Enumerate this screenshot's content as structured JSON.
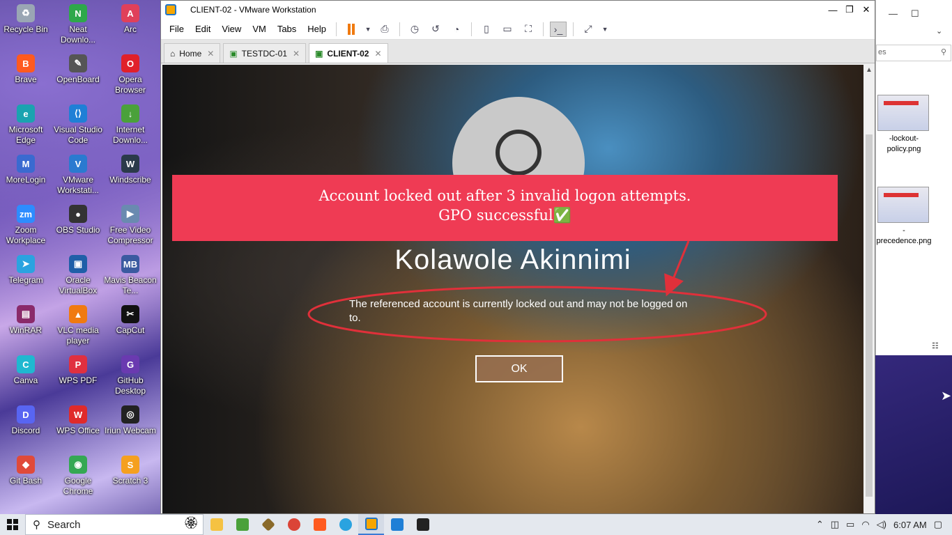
{
  "desktop_icons": [
    {
      "label": "Recycle Bin",
      "color": "#9aa6b4",
      "glyph": "♻"
    },
    {
      "label": "Neat Downlo...",
      "color": "#2ea84a",
      "glyph": "N"
    },
    {
      "label": "Arc",
      "color": "#e0405a",
      "glyph": "A"
    },
    {
      "label": "Brave",
      "color": "#ff5a1f",
      "glyph": "B"
    },
    {
      "label": "OpenBoard",
      "color": "#555555",
      "glyph": "✎"
    },
    {
      "label": "Opera Browser",
      "color": "#e0202a",
      "glyph": "O"
    },
    {
      "label": "Microsoft Edge",
      "color": "#1aa3b0",
      "glyph": "e"
    },
    {
      "label": "Visual Studio Code",
      "color": "#1f7fd6",
      "glyph": "⟨⟩"
    },
    {
      "label": "Internet Downlo...",
      "color": "#4aa13a",
      "glyph": "↓"
    },
    {
      "label": "MoreLogin",
      "color": "#3a6ad0",
      "glyph": "M"
    },
    {
      "label": "VMware Workstati...",
      "color": "#2a7ad0",
      "glyph": "V"
    },
    {
      "label": "Windscribe",
      "color": "#2b3a4a",
      "glyph": "W"
    },
    {
      "label": "Zoom Workplace",
      "color": "#2d8cff",
      "glyph": "zm"
    },
    {
      "label": "OBS Studio",
      "color": "#333333",
      "glyph": "●"
    },
    {
      "label": "Free Video Compressor",
      "color": "#6a8ab0",
      "glyph": "▶"
    },
    {
      "label": "Telegram",
      "color": "#2aa3e0",
      "glyph": "➤"
    },
    {
      "label": "Oracle VirtualBox",
      "color": "#1f5fa8",
      "glyph": "▣"
    },
    {
      "label": "Mavis Beacon Te...",
      "color": "#3a5aa0",
      "glyph": "MB"
    },
    {
      "label": "WinRAR",
      "color": "#8a2a6a",
      "glyph": "▤"
    },
    {
      "label": "VLC media player",
      "color": "#f07a10",
      "glyph": "▲"
    },
    {
      "label": "CapCut",
      "color": "#111111",
      "glyph": "✂"
    },
    {
      "label": "Canva",
      "color": "#1fb8d0",
      "glyph": "C"
    },
    {
      "label": "WPS PDF",
      "color": "#e03040",
      "glyph": "P"
    },
    {
      "label": "GitHub Desktop",
      "color": "#6a3ab0",
      "glyph": "G"
    },
    {
      "label": "Discord",
      "color": "#5865f2",
      "glyph": "D"
    },
    {
      "label": "WPS Office",
      "color": "#e02a2a",
      "glyph": "W"
    },
    {
      "label": "Iriun Webcam",
      "color": "#222222",
      "glyph": "◎"
    },
    {
      "label": "Git Bash",
      "color": "#e04a3a",
      "glyph": "◆"
    },
    {
      "label": "Google Chrome",
      "color": "#34a853",
      "glyph": "◉"
    },
    {
      "label": "Scratch 3",
      "color": "#f5a020",
      "glyph": "S"
    }
  ],
  "vmware": {
    "title": "CLIENT-02 - VMware Workstation",
    "menu": [
      "File",
      "Edit",
      "View",
      "VM",
      "Tabs",
      "Help"
    ],
    "tabs": [
      {
        "label": "Home"
      },
      {
        "label": "TESTDC-01"
      },
      {
        "label": "CLIENT-02"
      }
    ]
  },
  "login": {
    "username": "Kolawole Akinnimi",
    "message": "The referenced account is currently locked out and may not be logged on to.",
    "ok_label": "OK"
  },
  "banner": {
    "line1": "Account locked out after 3 invalid logon attempts.",
    "line2": "GPO  successful✅",
    "color": "#ef3b54"
  },
  "explorer": {
    "search_placeholder": "es",
    "files": [
      {
        "name": "-lockout-policy.png"
      },
      {
        "name": "-precedence.png"
      }
    ]
  },
  "taskbar": {
    "search_placeholder": "Search",
    "clock": "6:07 AM"
  }
}
